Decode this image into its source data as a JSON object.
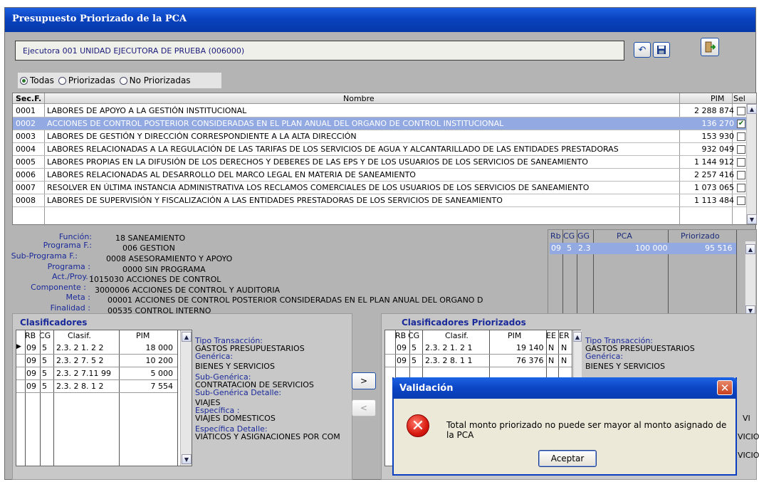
{
  "window": {
    "title": "Presupuesto Priorizado de la PCA"
  },
  "ejecutora": "Ejecutora  001  UNIDAD EJECUTORA DE PRUEBA (006000)",
  "filter": {
    "options": [
      "Todas",
      "Priorizadas",
      "No Priorizadas"
    ],
    "selected": "Todas"
  },
  "sec_grid": {
    "columns": [
      "Sec.F.",
      "Nombre",
      "PIM",
      "Sel"
    ],
    "rows": [
      {
        "sec": "0001",
        "nombre": "LABORES DE APOYO A LA GESTIÓN INSTITUCIONAL",
        "pim": "2 288 874",
        "sel": false
      },
      {
        "sec": "0002",
        "nombre": "ACCIONES DE CONTROL POSTERIOR CONSIDERADAS EN EL PLAN ANUAL DEL ORGANO DE CONTROL INSTITUCIONAL",
        "pim": "136 270",
        "sel": true
      },
      {
        "sec": "0003",
        "nombre": "LABORES DE GESTIÓN Y DIRECCIÓN CORRESPONDIENTE A LA ALTA DIRECCIÓN",
        "pim": "153 930",
        "sel": false
      },
      {
        "sec": "0004",
        "nombre": "LABORES RELACIONADAS A LA REGULACIÓN DE LAS TARIFAS DE LOS SERVICIOS DE AGUA Y ALCANTARILLADO DE LAS ENTIDADES PRESTADORAS",
        "pim": "932 049",
        "sel": false
      },
      {
        "sec": "0005",
        "nombre": "LABORES PROPIAS EN LA DIFUSIÓN DE LOS DERECHOS Y DEBERES DE LAS EPS Y DE LOS USUARIOS DE LOS SERVICIOS DE SANEAMIENTO",
        "pim": "1 144 912",
        "sel": false
      },
      {
        "sec": "0006",
        "nombre": "LABORES RELACIONADAS AL DESARROLLO DEL MARCO LEGAL EN MATERIA DE SANEAMIENTO",
        "pim": "2 257 416",
        "sel": false
      },
      {
        "sec": "0007",
        "nombre": "RESOLVER EN ÚLTIMA INSTANCIA ADMINISTRATIVA LOS RECLAMOS COMERCIALES DE LOS USUARIOS DE LOS SERVICIOS DE SANEAMIENTO",
        "pim": "1 073 065",
        "sel": false
      },
      {
        "sec": "0008",
        "nombre": "LABORES DE SUPERVISIÓN Y FISCALIZACIÓN A LAS ENTIDADES PRESTADORAS DE LOS SERVICIOS DE SANEAMIENTO",
        "pim": "1 113 484",
        "sel": false
      }
    ]
  },
  "info": [
    {
      "label": "Función:",
      "value": "18  SANEAMIENTO"
    },
    {
      "label": "Programa F.:",
      "value": "006  GESTION"
    },
    {
      "label": "Sub-Programa F.:",
      "value": "0008  ASESORAMIENTO Y APOYO"
    },
    {
      "label": "Programa :",
      "value": "0000  SIN PROGRAMA"
    },
    {
      "label": "Act./Proy. :",
      "value": "1015030  ACCIONES DE CONTROL"
    },
    {
      "label": "Componente :",
      "value": "3000006  ACCIONES DE CONTROL Y AUDITORIA"
    },
    {
      "label": "Meta :",
      "value": "00001  ACCIONES DE CONTROL POSTERIOR CONSIDERADAS EN EL PLAN ANUAL DEL ORGANO D"
    },
    {
      "label": "Finalidad :",
      "value": "00535  CONTROL INTERNO"
    }
  ],
  "pca_grid": {
    "columns": [
      "Rb",
      "CG",
      "GG",
      "PCA",
      "Priorizado"
    ],
    "row": {
      "rb": "09",
      "cg": "5",
      "gg": "2.3",
      "pca": "100 000",
      "priorizado": "95 516"
    }
  },
  "clasificadores": {
    "title": "Clasificadores",
    "columns": [
      "RB",
      "CG",
      "Clasif.",
      "PIM"
    ],
    "rows": [
      {
        "rb": "09",
        "cg": "5",
        "clasif": "2.3. 2  1. 2  2",
        "pim": "18 000"
      },
      {
        "rb": "09",
        "cg": "5",
        "clasif": "2.3. 2  7. 5  2",
        "pim": "10 200"
      },
      {
        "rb": "09",
        "cg": "5",
        "clasif": "2.3. 2  7.11 99",
        "pim": "5 000"
      },
      {
        "rb": "09",
        "cg": "5",
        "clasif": "2.3. 2  8. 1  2",
        "pim": "7 554"
      }
    ],
    "details": [
      {
        "k": "Tipo Transacción:",
        "v": "GASTOS PRESUPUESTARIOS"
      },
      {
        "k": "Genérica:",
        "v": "BIENES Y SERVICIOS"
      },
      {
        "k": "Sub-Genérica:",
        "v": "CONTRATACION DE SERVICIOS"
      },
      {
        "k": "Sub-Genérica Detalle:",
        "v": "VIAJES"
      },
      {
        "k": "Específica :",
        "v": "VIAJES DOMESTICOS"
      },
      {
        "k": "Específica Detalle:",
        "v": "VIÁTICOS Y ASIGNACIONES POR COM"
      }
    ]
  },
  "priorizados": {
    "title": "Clasificadores Priorizados",
    "columns": [
      "RB",
      "CG",
      "Clasif.",
      "PIM",
      "EE",
      "ER"
    ],
    "rows": [
      {
        "rb": "09",
        "cg": "5",
        "clasif": "2.3. 2  1. 2  1",
        "pim": "19 140",
        "ee": "N",
        "er": "N"
      },
      {
        "rb": "09",
        "cg": "5",
        "clasif": "2.3. 2  8. 1  1",
        "pim": "76 376",
        "ee": "N",
        "er": "N"
      }
    ],
    "details": [
      {
        "k": "Tipo Transacción:",
        "v": "GASTOS PRESUPUESTARIOS"
      },
      {
        "k": "Genérica:",
        "v": "BIENES Y SERVICIOS"
      }
    ],
    "clipped": [
      "VI",
      "VICIOS",
      "VICIOS"
    ]
  },
  "move_right": ">",
  "move_left": "<",
  "dialog": {
    "title": "Validación",
    "message": "Total monto priorizado no puede ser mayor al monto asignado de la PCA",
    "ok": "Aceptar"
  }
}
